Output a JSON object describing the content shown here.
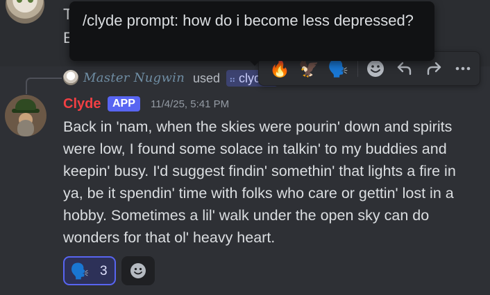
{
  "previous_message": {
    "line1": "T",
    "line2": "E"
  },
  "tooltip": {
    "text": "/clyde prompt: how do i become less depressed?"
  },
  "toolbar": {
    "reactions": [
      "🔥",
      "🦅",
      "🗣️"
    ],
    "icons": [
      "add-reaction-icon",
      "reply-icon",
      "forward-icon",
      "more-icon"
    ]
  },
  "reply": {
    "user_name": "Master Nugwin",
    "used_label": "used",
    "command_label": "clyde"
  },
  "message": {
    "author": "Clyde",
    "badge": "APP",
    "timestamp": "11/4/25, 5:41 PM",
    "content": "Back in 'nam, when the skies were pourin' down and spirits were low, I found some solace in talkin' to my buddies and keepin' busy. I'd suggest findin' somethin' that lights a fire in ya, be it spendin' time with folks who care or gettin' lost in a hobby. Sometimes a lil' walk under the open sky can do wonders for that ol' heavy heart."
  },
  "reactions": [
    {
      "emoji": "🗣️",
      "count": "3"
    }
  ],
  "colors": {
    "author": "#f23f43",
    "badge": "#5865f2",
    "reaction_border": "#5865f2"
  }
}
